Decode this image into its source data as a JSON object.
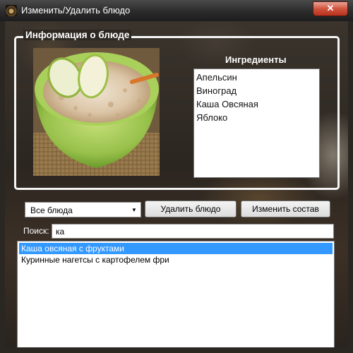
{
  "window": {
    "title": "Изменить/Удалить блюдо",
    "close_label": "✕"
  },
  "info_group": {
    "legend": "Информация о блюде",
    "ingredients_title": "Ингредиенты",
    "ingredients": [
      "Апельсин",
      "Виноград",
      "Каша Овсяная",
      "Яблоко"
    ]
  },
  "controls": {
    "category_selected": "Все блюда",
    "delete_label": "Удалить блюдо",
    "edit_label": "Изменить состав",
    "search_label": "Поиск:",
    "search_value": "ка"
  },
  "dishes": [
    {
      "name": "Каша овсяная с фруктами",
      "selected": true
    },
    {
      "name": "Куринные нагетсы с картофелем фри",
      "selected": false
    }
  ],
  "colors": {
    "selection": "#3399ff",
    "close_button": "#c8402b"
  }
}
